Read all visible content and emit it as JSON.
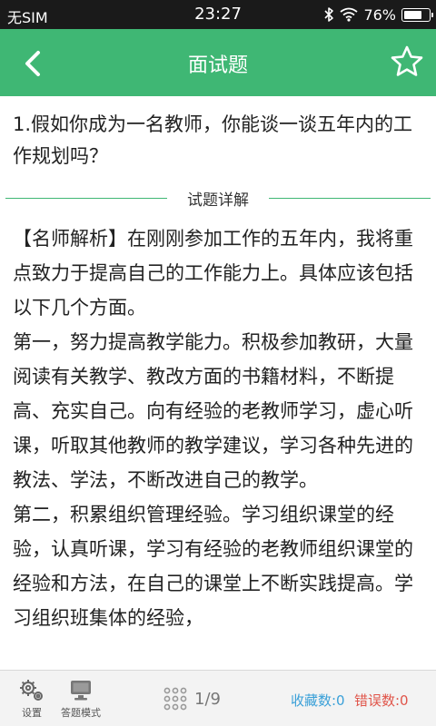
{
  "status_bar": {
    "carrier": "无SIM",
    "time": "23:27",
    "battery": "76%",
    "battery_level": 0.76
  },
  "header": {
    "title": "面试题",
    "back_icon": "chevron-left-icon",
    "favorite_icon": "star-outline-icon",
    "bg_color": "#3fb774"
  },
  "question": {
    "text": "1.假如你成为一名教师，你能谈一谈五年内的工作规划吗？"
  },
  "section": {
    "label": "试题详解"
  },
  "answer": {
    "paragraphs": [
      "【名师解析】在刚刚参加工作的五年内，我将重点致力于提高自己的工作能力上。具体应该包括以下几个方面。",
      "第一，努力提高教学能力。积极参加教研，大量阅读有关教学、教改方面的书籍材料，不断提高、充实自己。向有经验的老教师学习，虚心听课，听取其他教师的教学建议，学习各种先进的教法、学法，不断改进自己的教学。",
      "第二，积累组织管理经验。学习组织课堂的经验，认真听课，学习有经验的老教师组织课堂的经验和方法，在自己的课堂上不断实践提高。学习组织班集体的经验，"
    ]
  },
  "bottom_bar": {
    "settings_label": "设置",
    "mode_label": "答题模式",
    "page_indicator": "1/9",
    "favorites": "收藏数:0",
    "errors": "错误数:0",
    "favorites_color": "#3aa0d8",
    "errors_color": "#e0554a"
  }
}
